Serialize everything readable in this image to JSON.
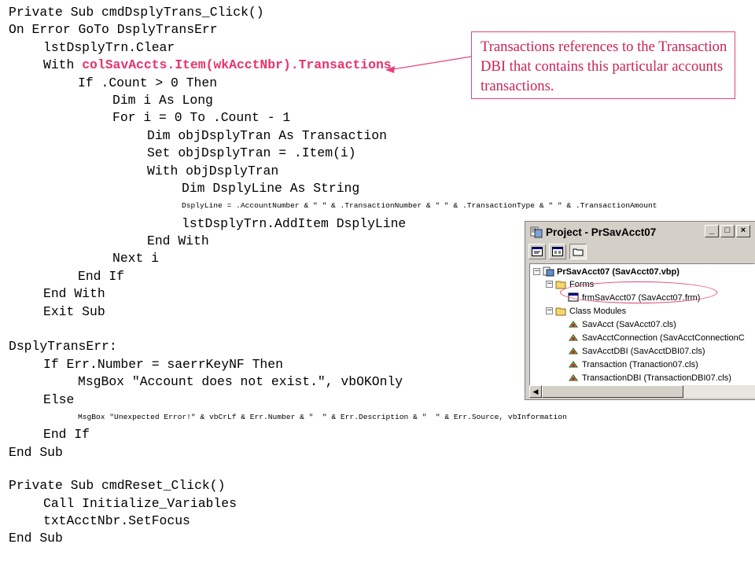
{
  "code_lines": [
    {
      "text": "Private Sub cmdDsplyTrans_Click()",
      "indent": 0
    },
    {
      "text": "On Error GoTo DsplyTransErr",
      "indent": 0
    },
    {
      "text": "lstDsplyTrn.Clear",
      "indent": 1
    },
    {
      "text": "With ",
      "highlight": "colSavAccts.Item(wkAcctNbr).Transactions",
      "indent": 1
    },
    {
      "text": "If .Count > 0 Then",
      "indent": 2
    },
    {
      "text": "Dim i As Long",
      "indent": 3
    },
    {
      "text": "For i = 0 To .Count - 1",
      "indent": 3
    },
    {
      "text": "Dim objDsplyTran As Transaction",
      "indent": 4
    },
    {
      "text": "Set objDsplyTran = .Item(i)",
      "indent": 4
    },
    {
      "text": "With objDsplyTran",
      "indent": 4
    },
    {
      "text": "Dim DsplyLine As String",
      "indent": 5
    },
    {
      "text": "DsplyLine = .AccountNumber & \" \" & .TransactionNumber & \" \" & .TransactionType & \" \" & .TransactionAmount",
      "indent": 5,
      "small": true
    },
    {
      "text": "lstDsplyTrn.AddItem DsplyLine",
      "indent": 5
    },
    {
      "text": "End With",
      "indent": 4
    },
    {
      "text": "Next i",
      "indent": 3
    },
    {
      "text": "End If",
      "indent": 2
    },
    {
      "text": "End With",
      "indent": 1
    },
    {
      "text": "Exit Sub",
      "indent": 1
    },
    {
      "text": "",
      "indent": 0
    },
    {
      "text": "DsplyTransErr:",
      "indent": 0
    },
    {
      "text": "If Err.Number = saerrKeyNF Then",
      "indent": 1
    },
    {
      "text": "MsgBox \"Account does not exist.\", vbOKOnly",
      "indent": 2
    },
    {
      "text": "Else",
      "indent": 1
    },
    {
      "text": "MsgBox \"Unexpected Error!\" & vbCrLf & Err.Number & \"  \" & Err.Description & \"  \" & Err.Source, vbInformation",
      "indent": 2,
      "small": true
    },
    {
      "text": "End If",
      "indent": 1
    },
    {
      "text": "End Sub",
      "indent": 0
    },
    {
      "text": "",
      "indent": 0,
      "gap": true
    },
    {
      "text": "Private Sub cmdReset_Click()",
      "indent": 0
    },
    {
      "text": "Call Initialize_Variables",
      "indent": 1
    },
    {
      "text": "txtAcctNbr.SetFocus",
      "indent": 1
    },
    {
      "text": "End Sub",
      "indent": 0
    }
  ],
  "callout": {
    "text": "Transactions references to the Transaction DBI that contains this particular accounts transactions."
  },
  "project_window": {
    "title": "Project - PrSavAcct07",
    "window_buttons": [
      "_",
      "□",
      "×"
    ],
    "toolbar": [
      "view-code-icon",
      "view-object-icon",
      "toggle-folders-icon"
    ],
    "project_node": "PrSavAcct07 (SavAcct07.vbp)",
    "folders": [
      {
        "name": "Forms",
        "items": [
          "frmSavAcct07 (SavAcct07.frm)"
        ]
      },
      {
        "name": "Class Modules",
        "items": [
          "SavAcct (SavAcct07.cls)",
          "SavAcctConnection (SavAcctConnectionC",
          "SavAcctDBI (SavAcctDBI07.cls)",
          "Transaction (Tranaction07.cls)",
          "TransactionDBI (TransactionDBI07.cls)"
        ]
      }
    ]
  },
  "colors": {
    "highlight": "#e8336d",
    "callout": "#cc2255",
    "window_face": "#d4d0c8"
  }
}
